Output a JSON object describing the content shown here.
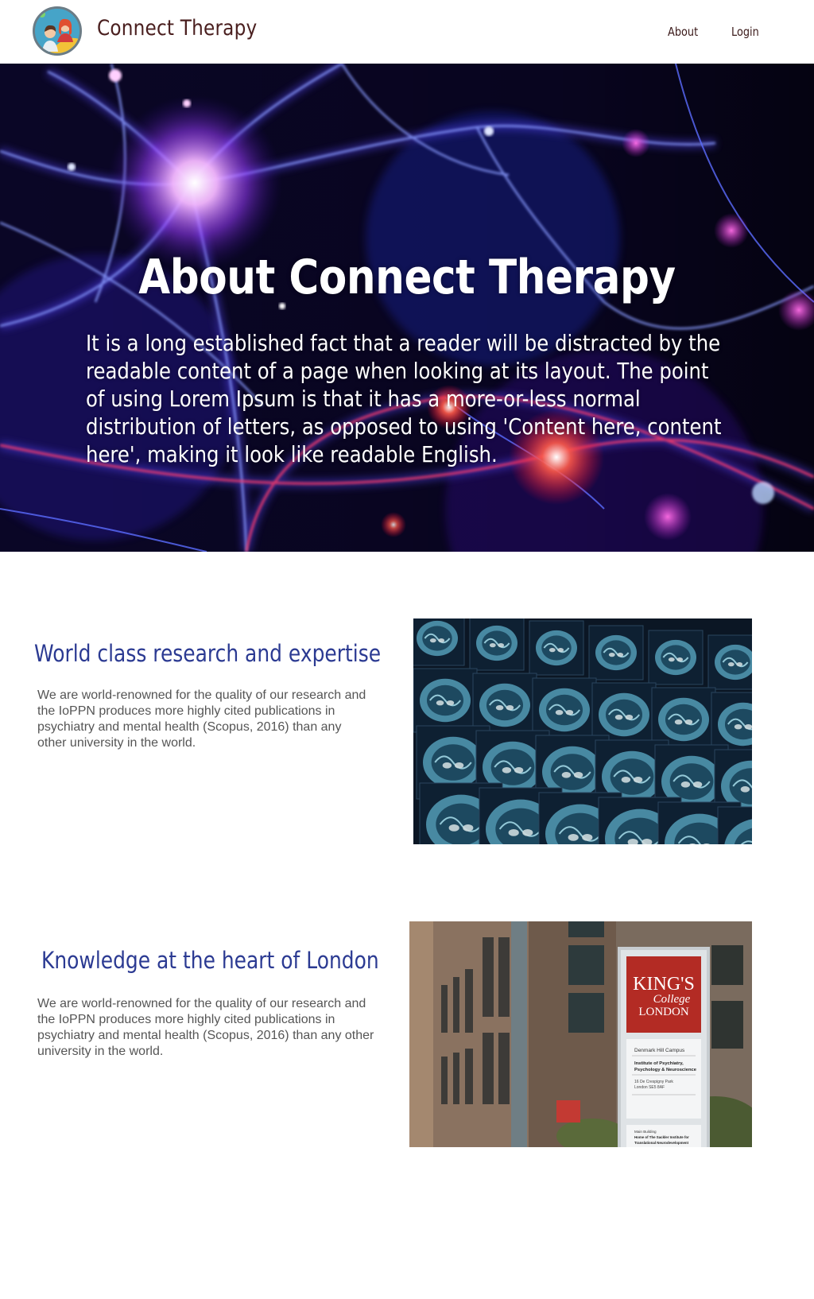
{
  "header": {
    "brand": "Connect Therapy",
    "logo_icon": "therapy-people-logo-icon",
    "nav": [
      {
        "label": "About"
      },
      {
        "label": "Login"
      }
    ]
  },
  "hero": {
    "title": "About Connect Therapy",
    "text": "It is a long established fact that a reader will be distracted by the readable content of a page when looking at its layout. The point of using Lorem Ipsum is that it has a more-or-less normal distribution of letters, as opposed to using 'Content here, content here', making it look like readable English.",
    "background": "neuron-image"
  },
  "sections": [
    {
      "title": "World class research and expertise",
      "text": "We are world-renowned for the quality of our research and the IoPPN produces more highly cited publications in psychiatry and mental health (Scopus, 2016) than any other university in the world.",
      "image": "brain-scan-image"
    },
    {
      "title": "Knowledge at the heart of London",
      "text": "We are world-renowned for the quality of our research and the IoPPN produces more highly cited publications in psychiatry and mental health (Scopus, 2016) than any other university in the world.",
      "image": "kings-college-sign-image",
      "sign": {
        "logo_line1": "KING'S",
        "logo_line2": "College",
        "logo_line3": "LONDON",
        "campus": "Denmark Hill Campus",
        "institute_line1": "Institute of Psychiatry,",
        "institute_line2": "Psychology & Neuroscience",
        "address_line1": "16 De Crespigny Park",
        "address_line2": "London SE5 8AF",
        "building_line1": "Main Building",
        "building_line2": "Home of The Sackler Institute for",
        "building_line3": "Translational Neurodevelopment"
      }
    }
  ],
  "colors": {
    "brand_text": "#4a1f1f",
    "section_title": "#2b3a92",
    "body_text": "#555555",
    "kings_red": "#b32b24"
  }
}
